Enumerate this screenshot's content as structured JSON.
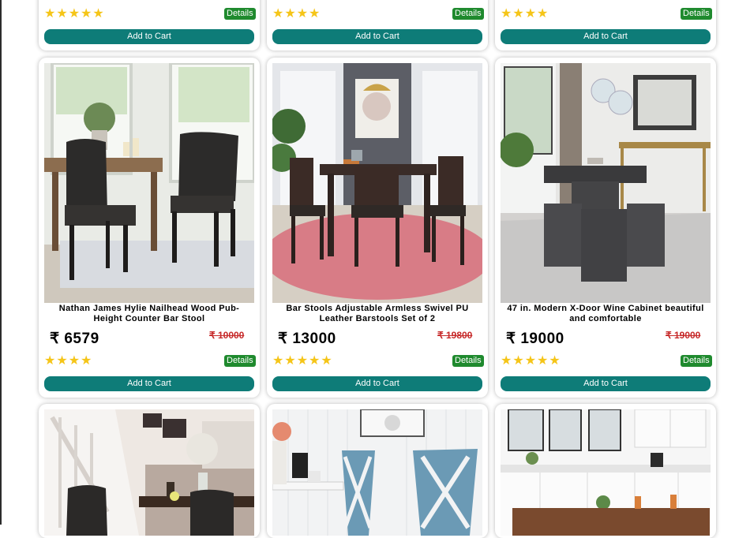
{
  "top_row": [
    {
      "rating_stars": "★★★★★",
      "details_label": "Details",
      "cart_label": "Add to Cart"
    },
    {
      "rating_stars": "★★★★",
      "details_label": "Details",
      "cart_label": "Add to Cart"
    },
    {
      "rating_stars": "★★★★",
      "details_label": "Details",
      "cart_label": "Add to Cart"
    }
  ],
  "middle_row": [
    {
      "image": "dining-chair-scene",
      "title": "Nathan James Hylie Nailhead Wood Pub-Height Counter Bar Stool",
      "price": "₹ 6579",
      "old_price": "₹ 10000",
      "rating_stars": "★★★★",
      "details_label": "Details",
      "cart_label": "Add to Cart"
    },
    {
      "image": "dining-set-pink-rug",
      "title": "Bar Stools Adjustable Armless Swivel PU Leather Barstools Set of 2",
      "price": "₹ 13000",
      "old_price": "₹ 19800",
      "rating_stars": "★★★★★",
      "details_label": "Details",
      "cart_label": "Add to Cart"
    },
    {
      "image": "wine-cabinet-table",
      "title": "47 in. Modern X-Door Wine Cabinet beautiful and comfortable",
      "price": "₹ 19000",
      "old_price": "₹ 19000",
      "rating_stars": "★★★★★",
      "details_label": "Details",
      "cart_label": "Add to Cart"
    }
  ],
  "bottom_row": [
    {
      "image": "staircase-chairs"
    },
    {
      "image": "blue-cross-back-chairs"
    },
    {
      "image": "white-kitchen"
    }
  ],
  "colors": {
    "cart_button": "#0e7c78",
    "details_button": "#1f8a2e",
    "old_price": "#c62828",
    "stars": "#f5c518"
  }
}
